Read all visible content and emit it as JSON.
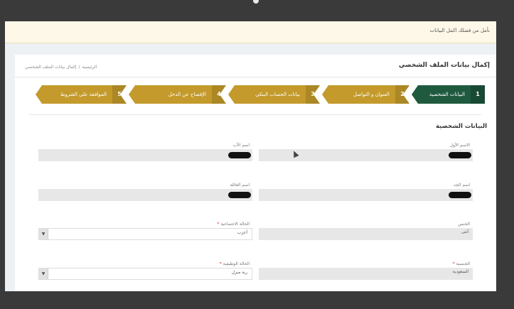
{
  "notice": {
    "text": "نأمل من فضلك اكمل البيانات"
  },
  "page": {
    "title": "إكمال بيانات الملف الشخصي",
    "breadcrumb": {
      "home": "الرئيسية",
      "current": "إكمال بيانات الملف الشخصي"
    }
  },
  "steps": [
    {
      "number": "1",
      "label": "البيانات الشخصية"
    },
    {
      "number": "2",
      "label": "العنوان و التواصل"
    },
    {
      "number": "3",
      "label": "بيانات الحساب البنكي"
    },
    {
      "number": "4",
      "label": "الإفصاح عن الدخل"
    },
    {
      "number": "5",
      "label": "الموافقة على الشروط"
    }
  ],
  "colors": {
    "step_active": "#1f5a3f",
    "step_inactive": "#c39a2b",
    "required": "#d33333"
  },
  "section": {
    "title": "البيانات الشخصية"
  },
  "fields": {
    "first_name": {
      "label": "الاسم الأول"
    },
    "father_name": {
      "label": "اسم الأب"
    },
    "grandfather_name": {
      "label": "اسم الجد"
    },
    "family_name": {
      "label": "اسم العائلة"
    },
    "gender": {
      "label": "الجنس",
      "value": "أنثى"
    },
    "marital_status": {
      "label": "الحالة الاجتماعية",
      "required_mark": "*",
      "value": "أعزب"
    },
    "nationality": {
      "label": "الجنسية",
      "required_mark": "*",
      "value": "السعودية"
    },
    "employment_status": {
      "label": "الحالة الوظيفية",
      "required_mark": "*",
      "value": "ربة منزل"
    }
  }
}
